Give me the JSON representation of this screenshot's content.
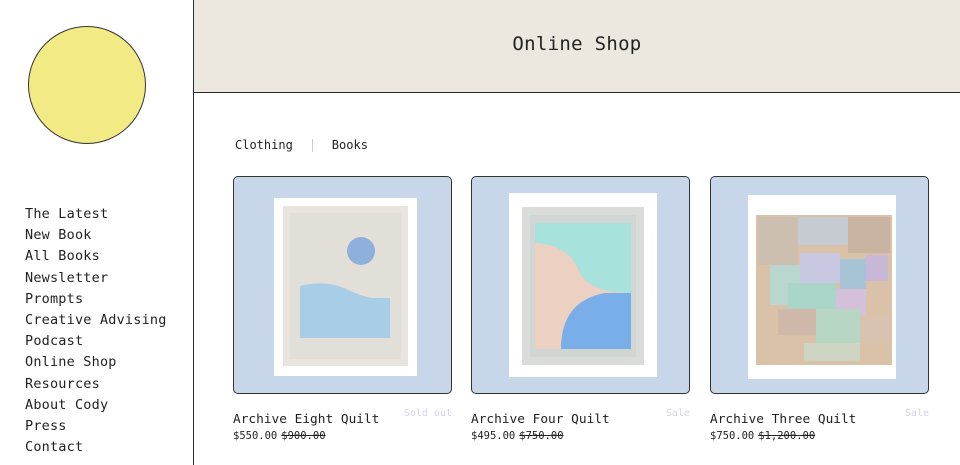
{
  "sidebar": {
    "nav": [
      "The Latest",
      "New Book",
      "All Books",
      "Newsletter",
      "Prompts",
      "Creative Advising",
      "Podcast",
      "Online Shop",
      "Resources",
      "About Cody",
      "Press",
      "Contact"
    ]
  },
  "header": {
    "title": "Online Shop"
  },
  "categories": [
    "Clothing",
    "Books"
  ],
  "products": [
    {
      "name": "Archive Eight Quilt",
      "badge": "Sold out",
      "price": "$550.00",
      "compare_price": "$900.00"
    },
    {
      "name": "Archive Four Quilt",
      "badge": "Sale",
      "price": "$495.00",
      "compare_price": "$750.00"
    },
    {
      "name": "Archive Three Quilt",
      "badge": "Sale",
      "price": "$750.00",
      "compare_price": "$1,200.00"
    }
  ],
  "colors": {
    "logo": "#f2ea84",
    "header_bg": "#ece8df",
    "card_bg": "#c8d6ea",
    "badge": "#d8d0f0"
  }
}
